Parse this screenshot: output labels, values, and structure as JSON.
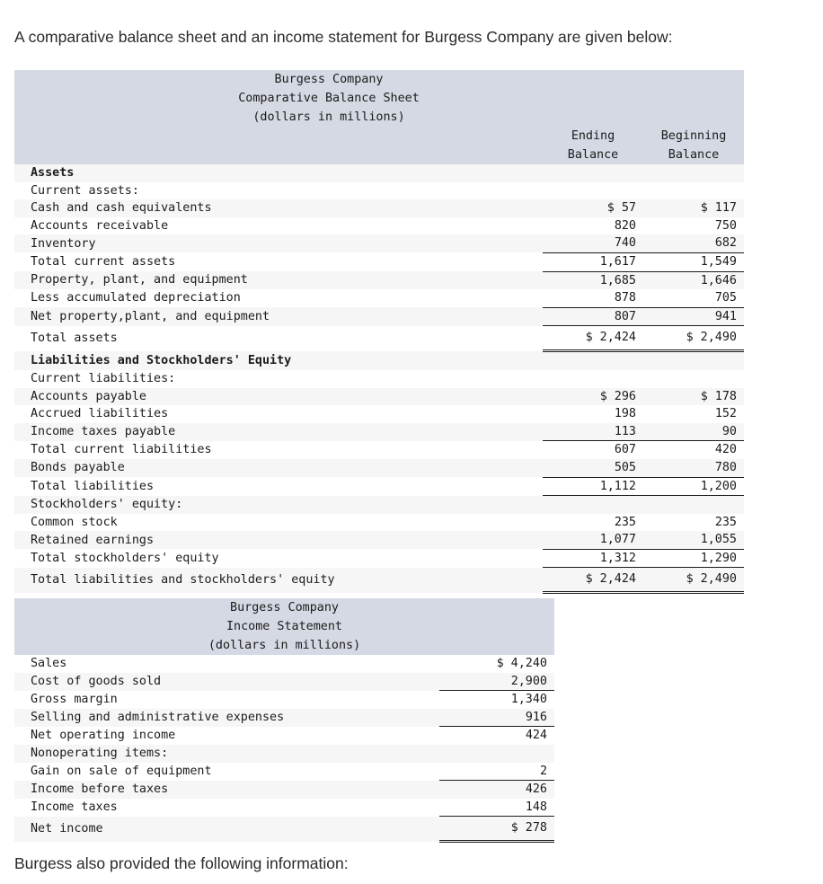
{
  "intro": "A comparative balance sheet and an income statement for Burgess Company are given below:",
  "outro": "Burgess also provided the following information:",
  "colors": {
    "header_bg": "#d5d9e3",
    "row_shade": "#f6f6f6",
    "row_plain": "#ffffff",
    "text": "#1b1b1b"
  },
  "balance_sheet": {
    "title_line1": "Burgess Company",
    "title_line2": "Comparative Balance Sheet",
    "title_line3": "(dollars in millions)",
    "col1_header_line1": "Ending",
    "col1_header_line2": "Balance",
    "col2_header_line1": "Beginning",
    "col2_header_line2": "Balance",
    "rows": [
      {
        "label": "Assets",
        "indent": 0,
        "bold": true,
        "ending": "",
        "beginning": "",
        "rule": "none"
      },
      {
        "label": "Current assets:",
        "indent": 0,
        "bold": false,
        "ending": "",
        "beginning": "",
        "rule": "none"
      },
      {
        "label": "Cash and cash equivalents",
        "indent": 1,
        "bold": false,
        "ending": "$ 57",
        "beginning": "$ 117",
        "rule": "none"
      },
      {
        "label": "Accounts receivable",
        "indent": 1,
        "bold": false,
        "ending": "820",
        "beginning": "750",
        "rule": "none"
      },
      {
        "label": "Inventory",
        "indent": 1,
        "bold": false,
        "ending": "740",
        "beginning": "682",
        "rule": "bottom"
      },
      {
        "label": "Total current assets",
        "indent": 0,
        "bold": false,
        "ending": "1,617",
        "beginning": "1,549",
        "rule": "bottom"
      },
      {
        "label": "Property, plant, and equipment",
        "indent": 0,
        "bold": false,
        "ending": "1,685",
        "beginning": "1,646",
        "rule": "none"
      },
      {
        "label": "Less accumulated depreciation",
        "indent": 1,
        "bold": false,
        "ending": "878",
        "beginning": "705",
        "rule": "bottom"
      },
      {
        "label": "Net property,plant, and equipment",
        "indent": 0,
        "bold": false,
        "ending": "807",
        "beginning": "941",
        "rule": "bottom"
      },
      {
        "label": "Total assets",
        "indent": 0,
        "bold": false,
        "ending": "$ 2,424",
        "beginning": "$ 2,490",
        "rule": "double",
        "tall": true
      },
      {
        "label": "Liabilities and Stockholders' Equity",
        "indent": 0,
        "bold": true,
        "ending": "",
        "beginning": "",
        "rule": "none"
      },
      {
        "label": "Current liabilities:",
        "indent": 0,
        "bold": false,
        "ending": "",
        "beginning": "",
        "rule": "none"
      },
      {
        "label": "Accounts payable",
        "indent": 1,
        "bold": false,
        "ending": "$ 296",
        "beginning": "$ 178",
        "rule": "none"
      },
      {
        "label": "Accrued liabilities",
        "indent": 1,
        "bold": false,
        "ending": "198",
        "beginning": "152",
        "rule": "none"
      },
      {
        "label": "Income taxes payable",
        "indent": 1,
        "bold": false,
        "ending": "113",
        "beginning": "90",
        "rule": "bottom"
      },
      {
        "label": "Total current liabilities",
        "indent": 0,
        "bold": false,
        "ending": "607",
        "beginning": "420",
        "rule": "none"
      },
      {
        "label": "Bonds payable",
        "indent": 0,
        "bold": false,
        "ending": "505",
        "beginning": "780",
        "rule": "bottom"
      },
      {
        "label": "Total liabilities",
        "indent": 0,
        "bold": false,
        "ending": "1,112",
        "beginning": "1,200",
        "rule": "bottom"
      },
      {
        "label": "Stockholders' equity:",
        "indent": 0,
        "bold": false,
        "ending": "",
        "beginning": "",
        "rule": "none"
      },
      {
        "label": "Common stock",
        "indent": 1,
        "bold": false,
        "ending": "235",
        "beginning": "235",
        "rule": "none"
      },
      {
        "label": "Retained earnings",
        "indent": 1,
        "bold": false,
        "ending": "1,077",
        "beginning": "1,055",
        "rule": "bottom"
      },
      {
        "label": "Total stockholders' equity",
        "indent": 0,
        "bold": false,
        "ending": "1,312",
        "beginning": "1,290",
        "rule": "bottom"
      },
      {
        "label": "Total liabilities and stockholders' equity",
        "indent": 0,
        "bold": false,
        "ending": "$ 2,424",
        "beginning": "$ 2,490",
        "rule": "double",
        "tall": true
      }
    ]
  },
  "income_statement": {
    "title_line1": "Burgess Company",
    "title_line2": "Income Statement",
    "title_line3": "(dollars in millions)",
    "rows": [
      {
        "label": "Sales",
        "indent": 0,
        "bold": false,
        "amount": "$ 4,240",
        "rule": "none"
      },
      {
        "label": "Cost of goods sold",
        "indent": 0,
        "bold": false,
        "amount": "2,900",
        "rule": "bottom"
      },
      {
        "label": "Gross margin",
        "indent": 0,
        "bold": false,
        "amount": "1,340",
        "rule": "none"
      },
      {
        "label": "Selling and administrative expenses",
        "indent": 0,
        "bold": false,
        "amount": "916",
        "rule": "bottom"
      },
      {
        "label": "Net operating income",
        "indent": 0,
        "bold": false,
        "amount": "424",
        "rule": "none"
      },
      {
        "label": "Nonoperating items:",
        "indent": 0,
        "bold": false,
        "amount": "",
        "rule": "none"
      },
      {
        "label": "Gain on sale of equipment",
        "indent": 1,
        "bold": false,
        "amount": "2",
        "rule": "bottom"
      },
      {
        "label": "Income before taxes",
        "indent": 0,
        "bold": false,
        "amount": "426",
        "rule": "none"
      },
      {
        "label": "Income taxes",
        "indent": 0,
        "bold": false,
        "amount": "148",
        "rule": "bottom"
      },
      {
        "label": "Net income",
        "indent": 0,
        "bold": false,
        "amount": "$ 278",
        "rule": "double",
        "tall": true
      }
    ]
  }
}
